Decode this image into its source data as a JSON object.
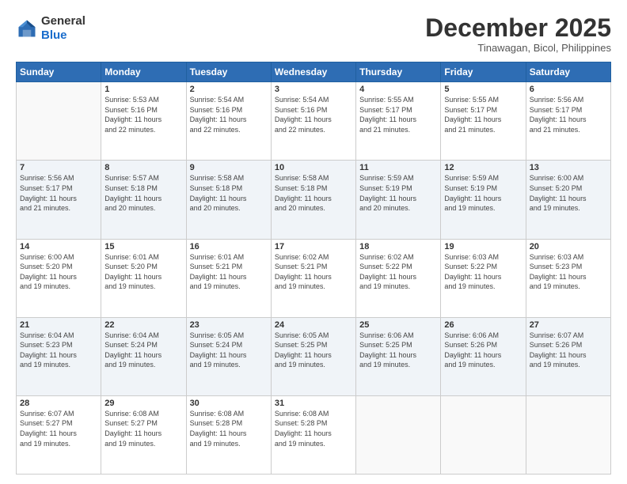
{
  "header": {
    "logo_line1": "General",
    "logo_line2": "Blue",
    "title": "December 2025",
    "subtitle": "Tinawagan, Bicol, Philippines"
  },
  "calendar": {
    "days_of_week": [
      "Sunday",
      "Monday",
      "Tuesday",
      "Wednesday",
      "Thursday",
      "Friday",
      "Saturday"
    ],
    "weeks": [
      [
        {
          "day": "",
          "info": ""
        },
        {
          "day": "1",
          "info": "Sunrise: 5:53 AM\nSunset: 5:16 PM\nDaylight: 11 hours\nand 22 minutes."
        },
        {
          "day": "2",
          "info": "Sunrise: 5:54 AM\nSunset: 5:16 PM\nDaylight: 11 hours\nand 22 minutes."
        },
        {
          "day": "3",
          "info": "Sunrise: 5:54 AM\nSunset: 5:16 PM\nDaylight: 11 hours\nand 22 minutes."
        },
        {
          "day": "4",
          "info": "Sunrise: 5:55 AM\nSunset: 5:17 PM\nDaylight: 11 hours\nand 21 minutes."
        },
        {
          "day": "5",
          "info": "Sunrise: 5:55 AM\nSunset: 5:17 PM\nDaylight: 11 hours\nand 21 minutes."
        },
        {
          "day": "6",
          "info": "Sunrise: 5:56 AM\nSunset: 5:17 PM\nDaylight: 11 hours\nand 21 minutes."
        }
      ],
      [
        {
          "day": "7",
          "info": "Sunrise: 5:56 AM\nSunset: 5:17 PM\nDaylight: 11 hours\nand 21 minutes."
        },
        {
          "day": "8",
          "info": "Sunrise: 5:57 AM\nSunset: 5:18 PM\nDaylight: 11 hours\nand 20 minutes."
        },
        {
          "day": "9",
          "info": "Sunrise: 5:58 AM\nSunset: 5:18 PM\nDaylight: 11 hours\nand 20 minutes."
        },
        {
          "day": "10",
          "info": "Sunrise: 5:58 AM\nSunset: 5:18 PM\nDaylight: 11 hours\nand 20 minutes."
        },
        {
          "day": "11",
          "info": "Sunrise: 5:59 AM\nSunset: 5:19 PM\nDaylight: 11 hours\nand 20 minutes."
        },
        {
          "day": "12",
          "info": "Sunrise: 5:59 AM\nSunset: 5:19 PM\nDaylight: 11 hours\nand 19 minutes."
        },
        {
          "day": "13",
          "info": "Sunrise: 6:00 AM\nSunset: 5:20 PM\nDaylight: 11 hours\nand 19 minutes."
        }
      ],
      [
        {
          "day": "14",
          "info": "Sunrise: 6:00 AM\nSunset: 5:20 PM\nDaylight: 11 hours\nand 19 minutes."
        },
        {
          "day": "15",
          "info": "Sunrise: 6:01 AM\nSunset: 5:20 PM\nDaylight: 11 hours\nand 19 minutes."
        },
        {
          "day": "16",
          "info": "Sunrise: 6:01 AM\nSunset: 5:21 PM\nDaylight: 11 hours\nand 19 minutes."
        },
        {
          "day": "17",
          "info": "Sunrise: 6:02 AM\nSunset: 5:21 PM\nDaylight: 11 hours\nand 19 minutes."
        },
        {
          "day": "18",
          "info": "Sunrise: 6:02 AM\nSunset: 5:22 PM\nDaylight: 11 hours\nand 19 minutes."
        },
        {
          "day": "19",
          "info": "Sunrise: 6:03 AM\nSunset: 5:22 PM\nDaylight: 11 hours\nand 19 minutes."
        },
        {
          "day": "20",
          "info": "Sunrise: 6:03 AM\nSunset: 5:23 PM\nDaylight: 11 hours\nand 19 minutes."
        }
      ],
      [
        {
          "day": "21",
          "info": "Sunrise: 6:04 AM\nSunset: 5:23 PM\nDaylight: 11 hours\nand 19 minutes."
        },
        {
          "day": "22",
          "info": "Sunrise: 6:04 AM\nSunset: 5:24 PM\nDaylight: 11 hours\nand 19 minutes."
        },
        {
          "day": "23",
          "info": "Sunrise: 6:05 AM\nSunset: 5:24 PM\nDaylight: 11 hours\nand 19 minutes."
        },
        {
          "day": "24",
          "info": "Sunrise: 6:05 AM\nSunset: 5:25 PM\nDaylight: 11 hours\nand 19 minutes."
        },
        {
          "day": "25",
          "info": "Sunrise: 6:06 AM\nSunset: 5:25 PM\nDaylight: 11 hours\nand 19 minutes."
        },
        {
          "day": "26",
          "info": "Sunrise: 6:06 AM\nSunset: 5:26 PM\nDaylight: 11 hours\nand 19 minutes."
        },
        {
          "day": "27",
          "info": "Sunrise: 6:07 AM\nSunset: 5:26 PM\nDaylight: 11 hours\nand 19 minutes."
        }
      ],
      [
        {
          "day": "28",
          "info": "Sunrise: 6:07 AM\nSunset: 5:27 PM\nDaylight: 11 hours\nand 19 minutes."
        },
        {
          "day": "29",
          "info": "Sunrise: 6:08 AM\nSunset: 5:27 PM\nDaylight: 11 hours\nand 19 minutes."
        },
        {
          "day": "30",
          "info": "Sunrise: 6:08 AM\nSunset: 5:28 PM\nDaylight: 11 hours\nand 19 minutes."
        },
        {
          "day": "31",
          "info": "Sunrise: 6:08 AM\nSunset: 5:28 PM\nDaylight: 11 hours\nand 19 minutes."
        },
        {
          "day": "",
          "info": ""
        },
        {
          "day": "",
          "info": ""
        },
        {
          "day": "",
          "info": ""
        }
      ]
    ]
  }
}
